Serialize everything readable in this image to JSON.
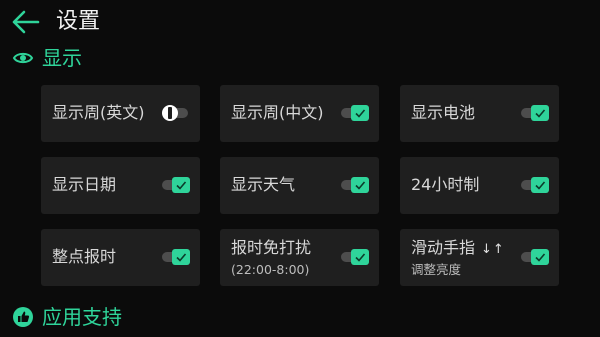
{
  "header": {
    "title": "设置",
    "accent_color": "#2fd49a"
  },
  "sections": {
    "display": {
      "label": "显示",
      "icon": "eye-icon"
    },
    "support": {
      "label": "应用支持",
      "icon": "thumbs-up-icon"
    }
  },
  "tiles": [
    {
      "label": "显示周(英文)",
      "sublabel": "",
      "toggle": false
    },
    {
      "label": "显示周(中文)",
      "sublabel": "",
      "toggle": true
    },
    {
      "label": "显示电池",
      "sublabel": "",
      "toggle": true
    },
    {
      "label": "显示日期",
      "sublabel": "",
      "toggle": true
    },
    {
      "label": "显示天气",
      "sublabel": "",
      "toggle": true
    },
    {
      "label": "24小时制",
      "sublabel": "",
      "toggle": true
    },
    {
      "label": "整点报时",
      "sublabel": "",
      "toggle": true
    },
    {
      "label": "报时免打扰",
      "sublabel": "(22:00-8:00)",
      "toggle": true
    },
    {
      "label": "滑动手指",
      "sublabel": "调整亮度",
      "toggle": true,
      "extra": "↓↑"
    }
  ]
}
